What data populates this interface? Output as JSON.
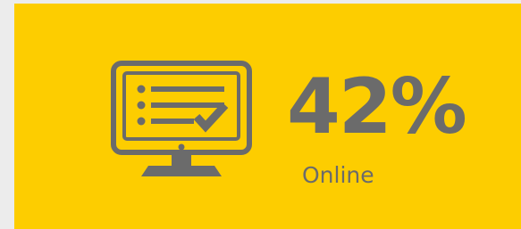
{
  "stat": {
    "value": "42%",
    "label": "Online"
  },
  "icon": {
    "name": "monitor-checklist-icon"
  },
  "colors": {
    "background": "#ececec",
    "card": "#fdcd00",
    "foreground": "#6b6b6b"
  }
}
